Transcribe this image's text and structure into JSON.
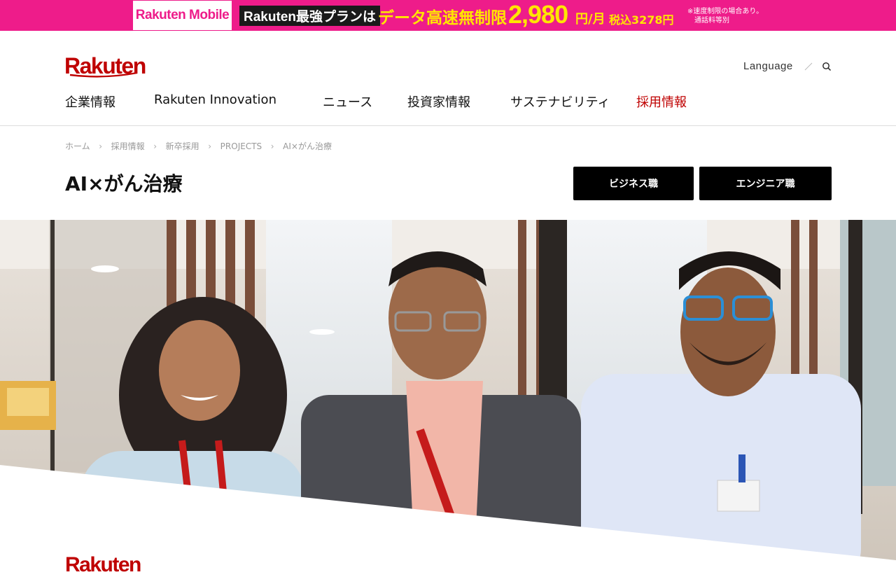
{
  "promo": {
    "logo": "Rakuten Mobile",
    "plan": "Rakuten最強プランは",
    "headline": "データ高速無制限",
    "price": "2,980",
    "unit": "円/月",
    "tax": "税込3278円",
    "note_line1": "※速度制限の場合あり。",
    "note_line2": "通話料等別",
    "bg_color": "#ee1c8a",
    "accent_color": "#ffe600"
  },
  "header": {
    "logo": "Rakuten",
    "language": "Language",
    "search_icon": "search-icon",
    "brand_color": "#bf0000"
  },
  "nav": [
    {
      "label": "企業情報"
    },
    {
      "label": "Rakuten Innovation"
    },
    {
      "label": "ニュース"
    },
    {
      "label": "投資家情報"
    },
    {
      "label": "サステナビリティ"
    },
    {
      "label": "採用情報"
    }
  ],
  "breadcrumb": [
    "ホーム",
    "採用情報",
    "新卒採用",
    "PROJECTS",
    "AI×がん治療"
  ],
  "page": {
    "title": "AI×がん治療",
    "btn_business": "ビジネス職",
    "btn_engineer": "エンジニア職",
    "partial_logo": "Rakuten"
  }
}
